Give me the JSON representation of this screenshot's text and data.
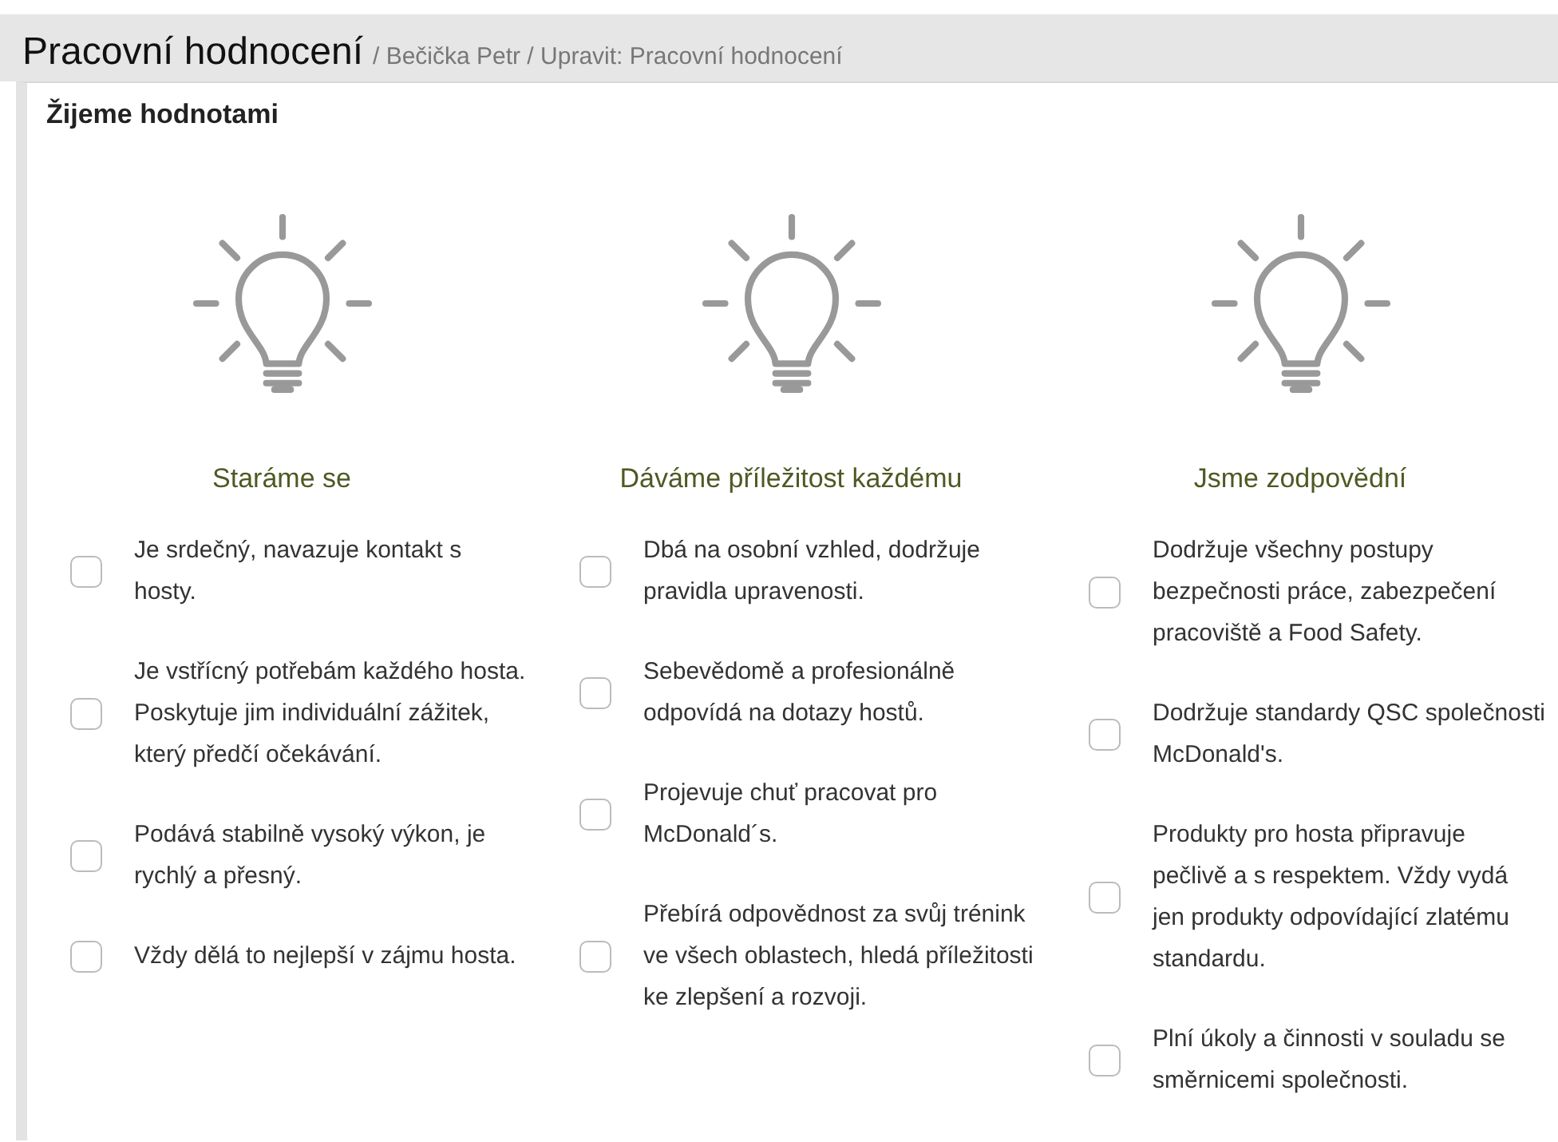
{
  "header": {
    "title": "Pracovní hodnocení",
    "breadcrumb": "/ Bečička Petr / Upravit: Pracovní hodnocení"
  },
  "section": {
    "title": "Žijeme hodnotami"
  },
  "values": [
    {
      "title": "Staráme se",
      "items": [
        {
          "text": "Je srdečný, navazuje kontakt s hosty.",
          "checked": false
        },
        {
          "text": "Je vstřícný potřebám každého hosta. Poskytuje jim individuální zážitek, který předčí očekávání.",
          "checked": false
        },
        {
          "text": "Podává stabilně vysoký výkon, je rychlý a přesný.",
          "checked": false
        },
        {
          "text": "Vždy dělá to nejlepší v zájmu hosta.",
          "checked": false
        }
      ]
    },
    {
      "title": "Dáváme příležitost každému",
      "items": [
        {
          "text": "Dbá na osobní vzhled, dodržuje pravidla upravenosti.",
          "checked": false
        },
        {
          "text": "Sebevědomě a profesionálně odpovídá na dotazy hostů.",
          "checked": false
        },
        {
          "text": "Projevuje chuť pracovat pro McDonald´s.",
          "checked": false
        },
        {
          "text": "Přebírá odpovědnost za svůj trénink ve všech oblastech, hledá příležitosti ke zlepšení a rozvoji.",
          "checked": false
        }
      ]
    },
    {
      "title": "Jsme zodpovědní",
      "items": [
        {
          "text": "Dodržuje všechny postupy bezpečnosti práce, zabezpečení pracoviště a Food Safety.",
          "checked": false
        },
        {
          "text": "Dodržuje standardy QSC společnosti McDonald's.",
          "checked": false
        },
        {
          "text": "Produkty pro hosta připravuje pečlivě a s respektem. Vždy vydá jen produkty odpovídající zlatému standardu.",
          "checked": false
        },
        {
          "text": "Plní úkoly a činnosti v souladu se směrnicemi společnosti.",
          "checked": false
        }
      ]
    }
  ]
}
